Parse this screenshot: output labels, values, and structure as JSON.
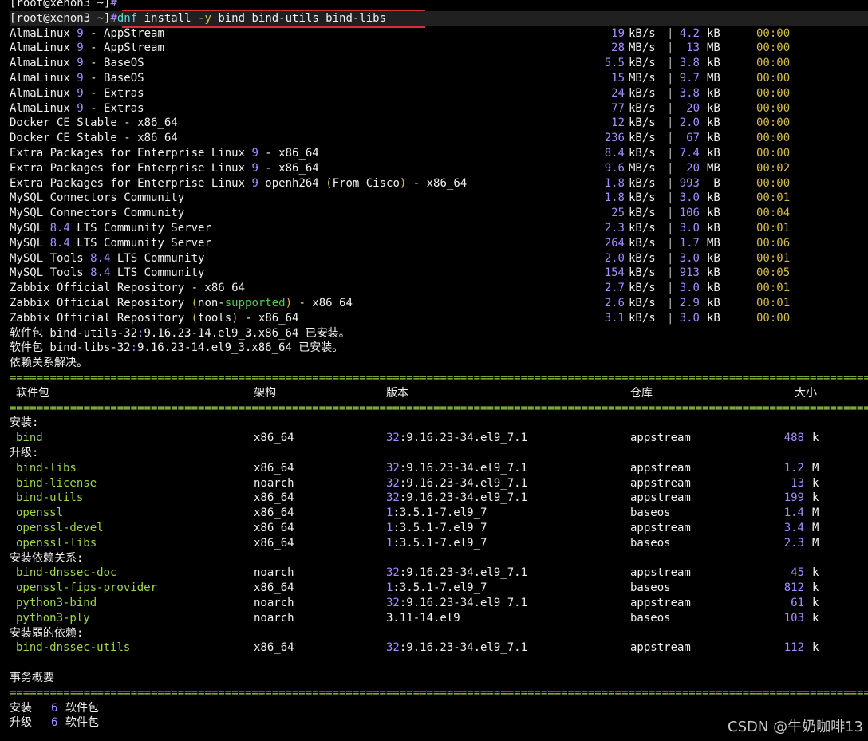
{
  "prompt": {
    "prev": "[root@xenon3 ~]",
    "cur": "[root@xenon3 ~]",
    "hash": "#"
  },
  "command": {
    "dnf": "dnf",
    "install": "install",
    "flag": "-y",
    "args": "bind bind-utils bind-libs"
  },
  "repos": [
    {
      "name": [
        [
          "AlmaLinux ",
          "w"
        ],
        [
          "9",
          "p"
        ],
        [
          " - AppStream",
          "w"
        ]
      ],
      "speed": "19",
      "speed_unit": "kB/s",
      "size": "4.2",
      "size_unit": "kB",
      "time": "00:00"
    },
    {
      "name": [
        [
          "AlmaLinux ",
          "w"
        ],
        [
          "9",
          "p"
        ],
        [
          " - AppStream",
          "w"
        ]
      ],
      "speed": "28",
      "speed_unit": "MB/s",
      "size": "13",
      "size_unit": "MB",
      "time": "00:00"
    },
    {
      "name": [
        [
          "AlmaLinux ",
          "w"
        ],
        [
          "9",
          "p"
        ],
        [
          " - BaseOS",
          "w"
        ]
      ],
      "speed": "5.5",
      "speed_unit": "kB/s",
      "size": "3.8",
      "size_unit": "kB",
      "time": "00:00"
    },
    {
      "name": [
        [
          "AlmaLinux ",
          "w"
        ],
        [
          "9",
          "p"
        ],
        [
          " - BaseOS",
          "w"
        ]
      ],
      "speed": "15",
      "speed_unit": "MB/s",
      "size": "9.7",
      "size_unit": "MB",
      "time": "00:00"
    },
    {
      "name": [
        [
          "AlmaLinux ",
          "w"
        ],
        [
          "9",
          "p"
        ],
        [
          " - Extras",
          "w"
        ]
      ],
      "speed": "24",
      "speed_unit": "kB/s",
      "size": "3.8",
      "size_unit": "kB",
      "time": "00:00"
    },
    {
      "name": [
        [
          "AlmaLinux ",
          "w"
        ],
        [
          "9",
          "p"
        ],
        [
          " - Extras",
          "w"
        ]
      ],
      "speed": "77",
      "speed_unit": "kB/s",
      "size": "20",
      "size_unit": "kB",
      "time": "00:00"
    },
    {
      "name": [
        [
          "Docker CE Stable - x86_64",
          "w"
        ]
      ],
      "speed": "12",
      "speed_unit": "kB/s",
      "size": "2.0",
      "size_unit": "kB",
      "time": "00:00"
    },
    {
      "name": [
        [
          "Docker CE Stable - x86_64",
          "w"
        ]
      ],
      "speed": "236",
      "speed_unit": "kB/s",
      "size": "67",
      "size_unit": "kB",
      "time": "00:00"
    },
    {
      "name": [
        [
          "Extra Packages for Enterprise Linux ",
          "w"
        ],
        [
          "9",
          "p"
        ],
        [
          " - x86_64",
          "w"
        ]
      ],
      "speed": "8.4",
      "speed_unit": "kB/s",
      "size": "7.4",
      "size_unit": "kB",
      "time": "00:00"
    },
    {
      "name": [
        [
          "Extra Packages for Enterprise Linux ",
          "w"
        ],
        [
          "9",
          "p"
        ],
        [
          " - x86_64",
          "w"
        ]
      ],
      "speed": "9.6",
      "speed_unit": "MB/s",
      "size": "20",
      "size_unit": "MB",
      "time": "00:02"
    },
    {
      "name": [
        [
          "Extra Packages for Enterprise Linux ",
          "w"
        ],
        [
          "9",
          "p"
        ],
        [
          " openh264 ",
          "w"
        ],
        [
          "(",
          "y"
        ],
        [
          "From Cisco",
          "w"
        ],
        [
          ")",
          "y"
        ],
        [
          " - x86_64",
          "w"
        ]
      ],
      "speed": "1.8",
      "speed_unit": "kB/s",
      "size": "993",
      "size_unit": " B",
      "time": "00:00"
    },
    {
      "name": [
        [
          "MySQL Connectors Community",
          "w"
        ]
      ],
      "speed": "1.8",
      "speed_unit": "kB/s",
      "size": "3.0",
      "size_unit": "kB",
      "time": "00:01"
    },
    {
      "name": [
        [
          "MySQL Connectors Community",
          "w"
        ]
      ],
      "speed": "25",
      "speed_unit": "kB/s",
      "size": "106",
      "size_unit": "kB",
      "time": "00:04"
    },
    {
      "name": [
        [
          "MySQL ",
          "w"
        ],
        [
          "8.4",
          "p"
        ],
        [
          " LTS Community Server",
          "w"
        ]
      ],
      "speed": "2.3",
      "speed_unit": "kB/s",
      "size": "3.0",
      "size_unit": "kB",
      "time": "00:01"
    },
    {
      "name": [
        [
          "MySQL ",
          "w"
        ],
        [
          "8.4",
          "p"
        ],
        [
          " LTS Community Server",
          "w"
        ]
      ],
      "speed": "264",
      "speed_unit": "kB/s",
      "size": "1.7",
      "size_unit": "MB",
      "time": "00:06"
    },
    {
      "name": [
        [
          "MySQL Tools ",
          "w"
        ],
        [
          "8.4",
          "p"
        ],
        [
          " LTS Community",
          "w"
        ]
      ],
      "speed": "2.0",
      "speed_unit": "kB/s",
      "size": "3.0",
      "size_unit": "kB",
      "time": "00:01"
    },
    {
      "name": [
        [
          "MySQL Tools ",
          "w"
        ],
        [
          "8.4",
          "p"
        ],
        [
          " LTS Community",
          "w"
        ]
      ],
      "speed": "154",
      "speed_unit": "kB/s",
      "size": "913",
      "size_unit": "kB",
      "time": "00:05"
    },
    {
      "name": [
        [
          "Zabbix Official Repository - x86_64",
          "w"
        ]
      ],
      "speed": "2.7",
      "speed_unit": "kB/s",
      "size": "3.0",
      "size_unit": "kB",
      "time": "00:01"
    },
    {
      "name": [
        [
          "Zabbix Official Repository ",
          "w"
        ],
        [
          "(",
          "y"
        ],
        [
          "non-",
          "w"
        ],
        [
          "supported",
          "g"
        ],
        [
          ")",
          "y"
        ],
        [
          " - x86_64",
          "w"
        ]
      ],
      "speed": "2.6",
      "speed_unit": "kB/s",
      "size": "2.9",
      "size_unit": "kB",
      "time": "00:01"
    },
    {
      "name": [
        [
          "Zabbix Official Repository ",
          "w"
        ],
        [
          "(",
          "y"
        ],
        [
          "tools",
          "w"
        ],
        [
          ")",
          "y"
        ],
        [
          " - x86_64",
          "w"
        ]
      ],
      "speed": "3.1",
      "speed_unit": "kB/s",
      "size": "3.0",
      "size_unit": "kB",
      "time": "00:00"
    }
  ],
  "installed_msgs": [
    [
      [
        "软件包 bind-utils-32",
        "w"
      ],
      [
        ":",
        "p"
      ],
      [
        "9.16.23-14.el9_3.x86_64 已安装。",
        "w"
      ]
    ],
    [
      [
        "软件包 bind-libs-32",
        "w"
      ],
      [
        ":",
        "p"
      ],
      [
        "9.16.23-14.el9_3.x86_64 已安装。",
        "w"
      ]
    ]
  ],
  "resolved_msg": "依赖关系解决。",
  "rule": "==================================================================================================================================",
  "headers": {
    "package": "软件包",
    "arch": "架构",
    "version": "版本",
    "repo": "仓库",
    "size": "大小"
  },
  "sections": [
    {
      "title": "安装:",
      "packages": [
        {
          "name": "bind",
          "arch": "x86_64",
          "epoch": "32",
          "ver": ":9.16.23-34.el9_7.1",
          "repo": "appstream",
          "size": "488",
          "unit": "k"
        }
      ]
    },
    {
      "title": "升级:",
      "packages": [
        {
          "name": "bind-libs",
          "arch": "x86_64",
          "epoch": "32",
          "ver": ":9.16.23-34.el9_7.1",
          "repo": "appstream",
          "size": "1.2",
          "unit": "M"
        },
        {
          "name": "bind-license",
          "arch": "noarch",
          "epoch": "32",
          "ver": ":9.16.23-34.el9_7.1",
          "repo": "appstream",
          "size": "13",
          "unit": "k"
        },
        {
          "name": "bind-utils",
          "arch": "x86_64",
          "epoch": "32",
          "ver": ":9.16.23-34.el9_7.1",
          "repo": "appstream",
          "size": "199",
          "unit": "k"
        },
        {
          "name": "openssl",
          "arch": "x86_64",
          "epoch": "1",
          "ver": ":3.5.1-7.el9_7",
          "repo": "baseos",
          "size": "1.4",
          "unit": "M"
        },
        {
          "name": "openssl-devel",
          "arch": "x86_64",
          "epoch": "1",
          "ver": ":3.5.1-7.el9_7",
          "repo": "appstream",
          "size": "3.4",
          "unit": "M"
        },
        {
          "name": "openssl-libs",
          "arch": "x86_64",
          "epoch": "1",
          "ver": ":3.5.1-7.el9_7",
          "repo": "baseos",
          "size": "2.3",
          "unit": "M"
        }
      ]
    },
    {
      "title": "安装依赖关系:",
      "packages": [
        {
          "name": "bind-dnssec-doc",
          "arch": "noarch",
          "epoch": "32",
          "ver": ":9.16.23-34.el9_7.1",
          "repo": "appstream",
          "size": "45",
          "unit": "k"
        },
        {
          "name": "openssl-fips-provider",
          "arch": "x86_64",
          "epoch": "1",
          "ver": ":3.5.1-7.el9_7",
          "repo": "baseos",
          "size": "812",
          "unit": "k"
        },
        {
          "name": "python3-bind",
          "arch": "noarch",
          "epoch": "32",
          "ver": ":9.16.23-34.el9_7.1",
          "repo": "appstream",
          "size": "61",
          "unit": "k"
        },
        {
          "name": "python3-ply",
          "arch": "noarch",
          "epoch": "",
          "ver": "3.11-14.el9",
          "repo": "baseos",
          "size": "103",
          "unit": "k"
        }
      ]
    },
    {
      "title": "安装弱的依赖:",
      "packages": [
        {
          "name": "bind-dnssec-utils",
          "arch": "x86_64",
          "epoch": "32",
          "ver": ":9.16.23-34.el9_7.1",
          "repo": "appstream",
          "size": "112",
          "unit": "k"
        }
      ]
    }
  ],
  "summary_title": "事务概要",
  "summary": [
    {
      "label": "安装",
      "count": "6",
      "unit": "软件包"
    },
    {
      "label": "升级",
      "count": "6",
      "unit": "软件包"
    }
  ],
  "watermark": "CSDN @牛奶咖啡13"
}
